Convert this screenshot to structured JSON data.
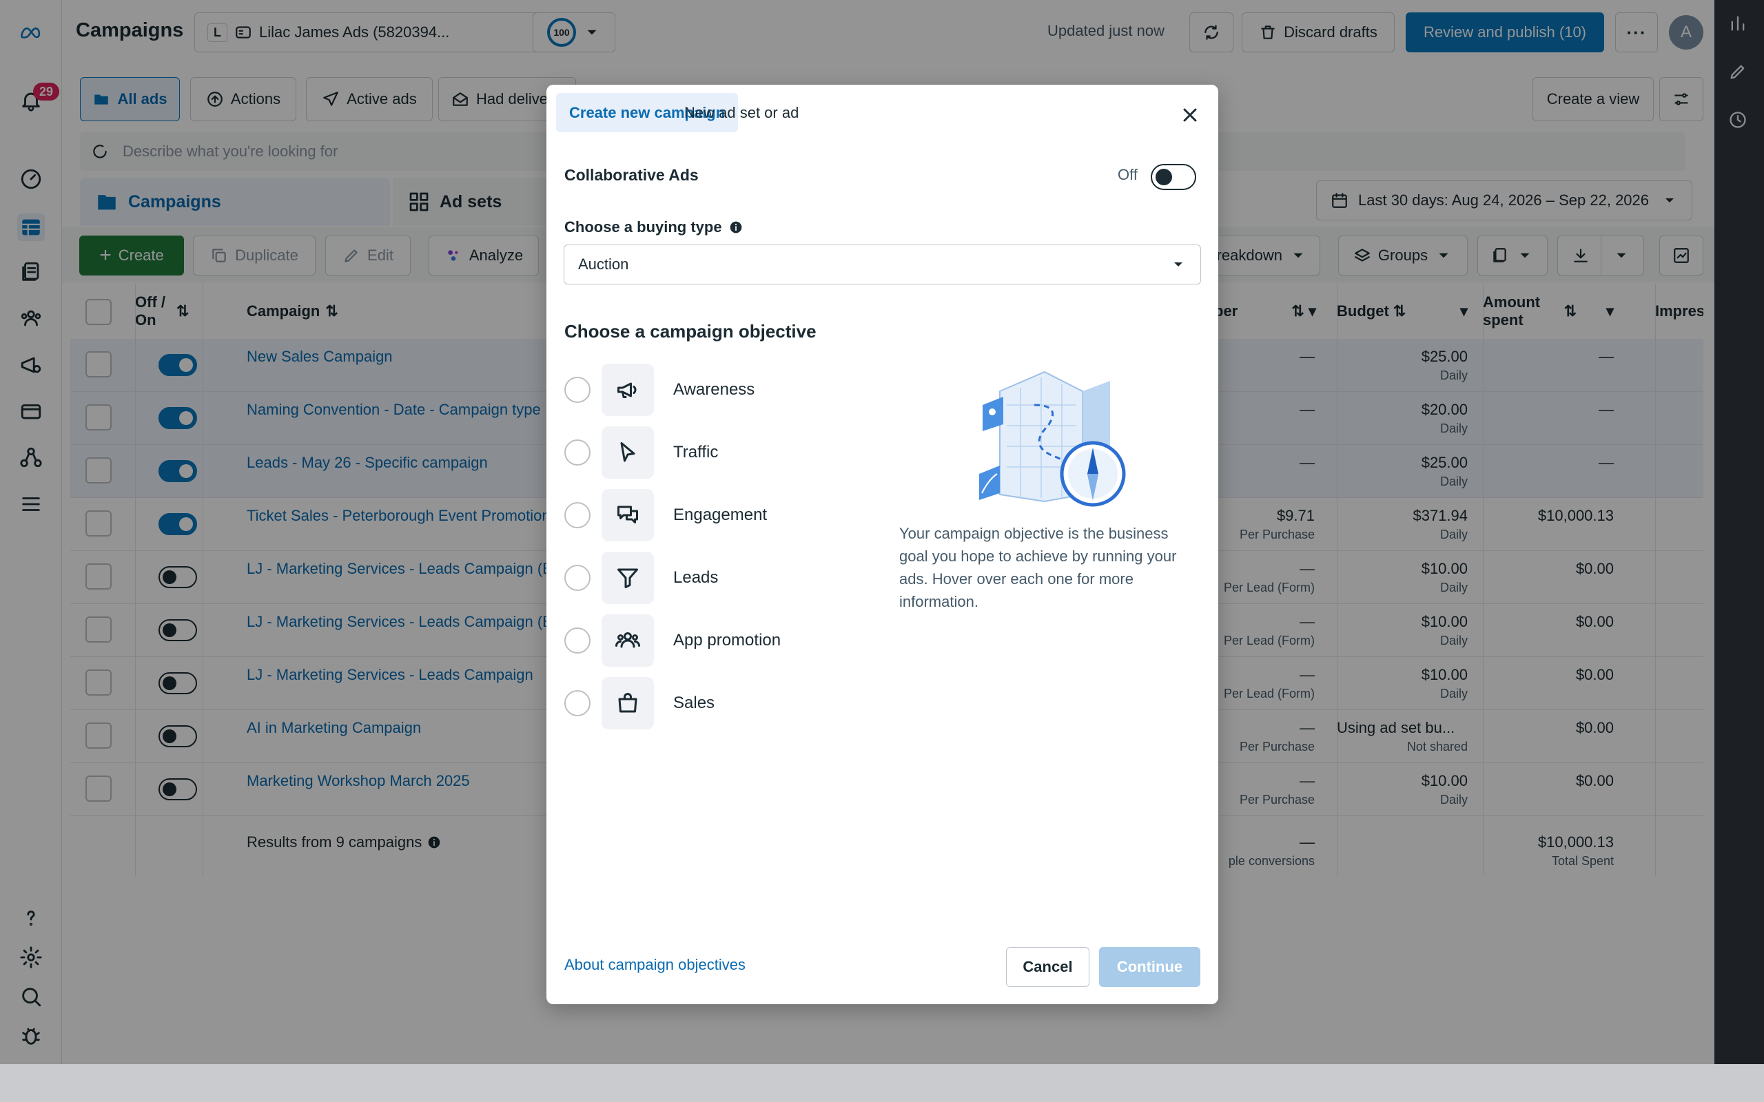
{
  "header": {
    "title": "Campaigns",
    "account_initial": "L",
    "account_name": "Lilac James Ads (5820394...",
    "score": "100",
    "updated": "Updated just now",
    "discard_label": "Discard drafts",
    "review_label": "Review and publish (10)",
    "avatar_letter": "A",
    "notifications": "29"
  },
  "filters": {
    "all_ads": "All ads",
    "actions": "Actions",
    "active_ads": "Active ads",
    "had_delivery": "Had delive",
    "create_view": "Create a view"
  },
  "search": {
    "placeholder": "Describe what you're looking for"
  },
  "level_tabs": {
    "campaigns": "Campaigns",
    "adsets": "Ad sets"
  },
  "date_range": "Last 30 days: Aug 24, 2026 – Sep 22, 2026",
  "toolbar": {
    "create": "Create",
    "duplicate": "Duplicate",
    "edit": "Edit",
    "analyze": "Analyze",
    "breakdown": "Breakdown",
    "groups": "Groups"
  },
  "table": {
    "col_offon_1": "Off /",
    "col_offon_2": "On",
    "col_campaign": "Campaign",
    "col_per": "per",
    "col_budget": "Budget",
    "col_amount_1": "Amount",
    "col_amount_2": "spent",
    "col_impressions": "Impressi",
    "rows": [
      {
        "name": "New Sales Campaign",
        "on": true,
        "hl": true,
        "result": "—",
        "result_sub": "",
        "budget": "$25.00",
        "budget_sub": "Daily",
        "spent": "—"
      },
      {
        "name": "Naming Convention - Date - Campaign type",
        "on": true,
        "hl": true,
        "result": "—",
        "result_sub": "",
        "budget": "$20.00",
        "budget_sub": "Daily",
        "spent": "—"
      },
      {
        "name": "Leads - May 26 - Specific campaign",
        "on": true,
        "hl": true,
        "result": "—",
        "result_sub": "",
        "budget": "$25.00",
        "budget_sub": "Daily",
        "spent": "—"
      },
      {
        "name": "Ticket Sales - Peterborough Event Promotion",
        "on": true,
        "hl": false,
        "result": "$9.71",
        "result_sub": "Per Purchase",
        "budget": "$371.94",
        "budget_sub": "Daily",
        "spent": "$10,000.13"
      },
      {
        "name": "LJ - Marketing Services - Leads Campaign (B",
        "on": false,
        "hl": false,
        "result": "—",
        "result_sub": "Per Lead (Form)",
        "budget": "$10.00",
        "budget_sub": "Daily",
        "spent": "$0.00"
      },
      {
        "name": "LJ - Marketing Services - Leads Campaign (B",
        "on": false,
        "hl": false,
        "result": "—",
        "result_sub": "Per Lead (Form)",
        "budget": "$10.00",
        "budget_sub": "Daily",
        "spent": "$0.00"
      },
      {
        "name": "LJ - Marketing Services - Leads Campaign",
        "on": false,
        "hl": false,
        "result": "—",
        "result_sub": "Per Lead (Form)",
        "budget": "$10.00",
        "budget_sub": "Daily",
        "spent": "$0.00"
      },
      {
        "name": "AI in Marketing Campaign",
        "on": false,
        "hl": false,
        "result": "—",
        "result_sub": "Per Purchase",
        "budget": "Using ad set bu...",
        "budget_sub": "Not shared",
        "spent": "$0.00"
      },
      {
        "name": "Marketing Workshop March 2025",
        "on": false,
        "hl": false,
        "result": "—",
        "result_sub": "Per Purchase",
        "budget": "$10.00",
        "budget_sub": "Daily",
        "spent": "$0.00"
      }
    ],
    "summary_label": "Results from 9 campaigns",
    "summary_result": "—",
    "summary_result_sub": "ple conversions",
    "summary_spent": "$10,000.13",
    "summary_spent_sub": "Total Spent"
  },
  "modal": {
    "tab_create": "Create new campaign",
    "tab_new": "New ad set or ad",
    "collab_label": "Collaborative Ads",
    "collab_state": "Off",
    "buying_label": "Choose a buying type",
    "buying_value": "Auction",
    "objective_title": "Choose a campaign objective",
    "objectives": [
      {
        "label": "Awareness",
        "icon": "megaphone-icon"
      },
      {
        "label": "Traffic",
        "icon": "cursor-icon"
      },
      {
        "label": "Engagement",
        "icon": "chat-bubbles-icon"
      },
      {
        "label": "Leads",
        "icon": "funnel-icon"
      },
      {
        "label": "App promotion",
        "icon": "people-icon"
      },
      {
        "label": "Sales",
        "icon": "shopping-bag-icon"
      }
    ],
    "description": "Your campaign objective is the business goal you hope to achieve by running your ads. Hover over each one for more information.",
    "about_link": "About campaign objectives",
    "cancel": "Cancel",
    "continue": "Continue"
  },
  "colors": {
    "accent": "#0a78be",
    "link": "#0a6bb1",
    "create_green": "#1f7a3c",
    "badge_red": "#e0245e"
  }
}
